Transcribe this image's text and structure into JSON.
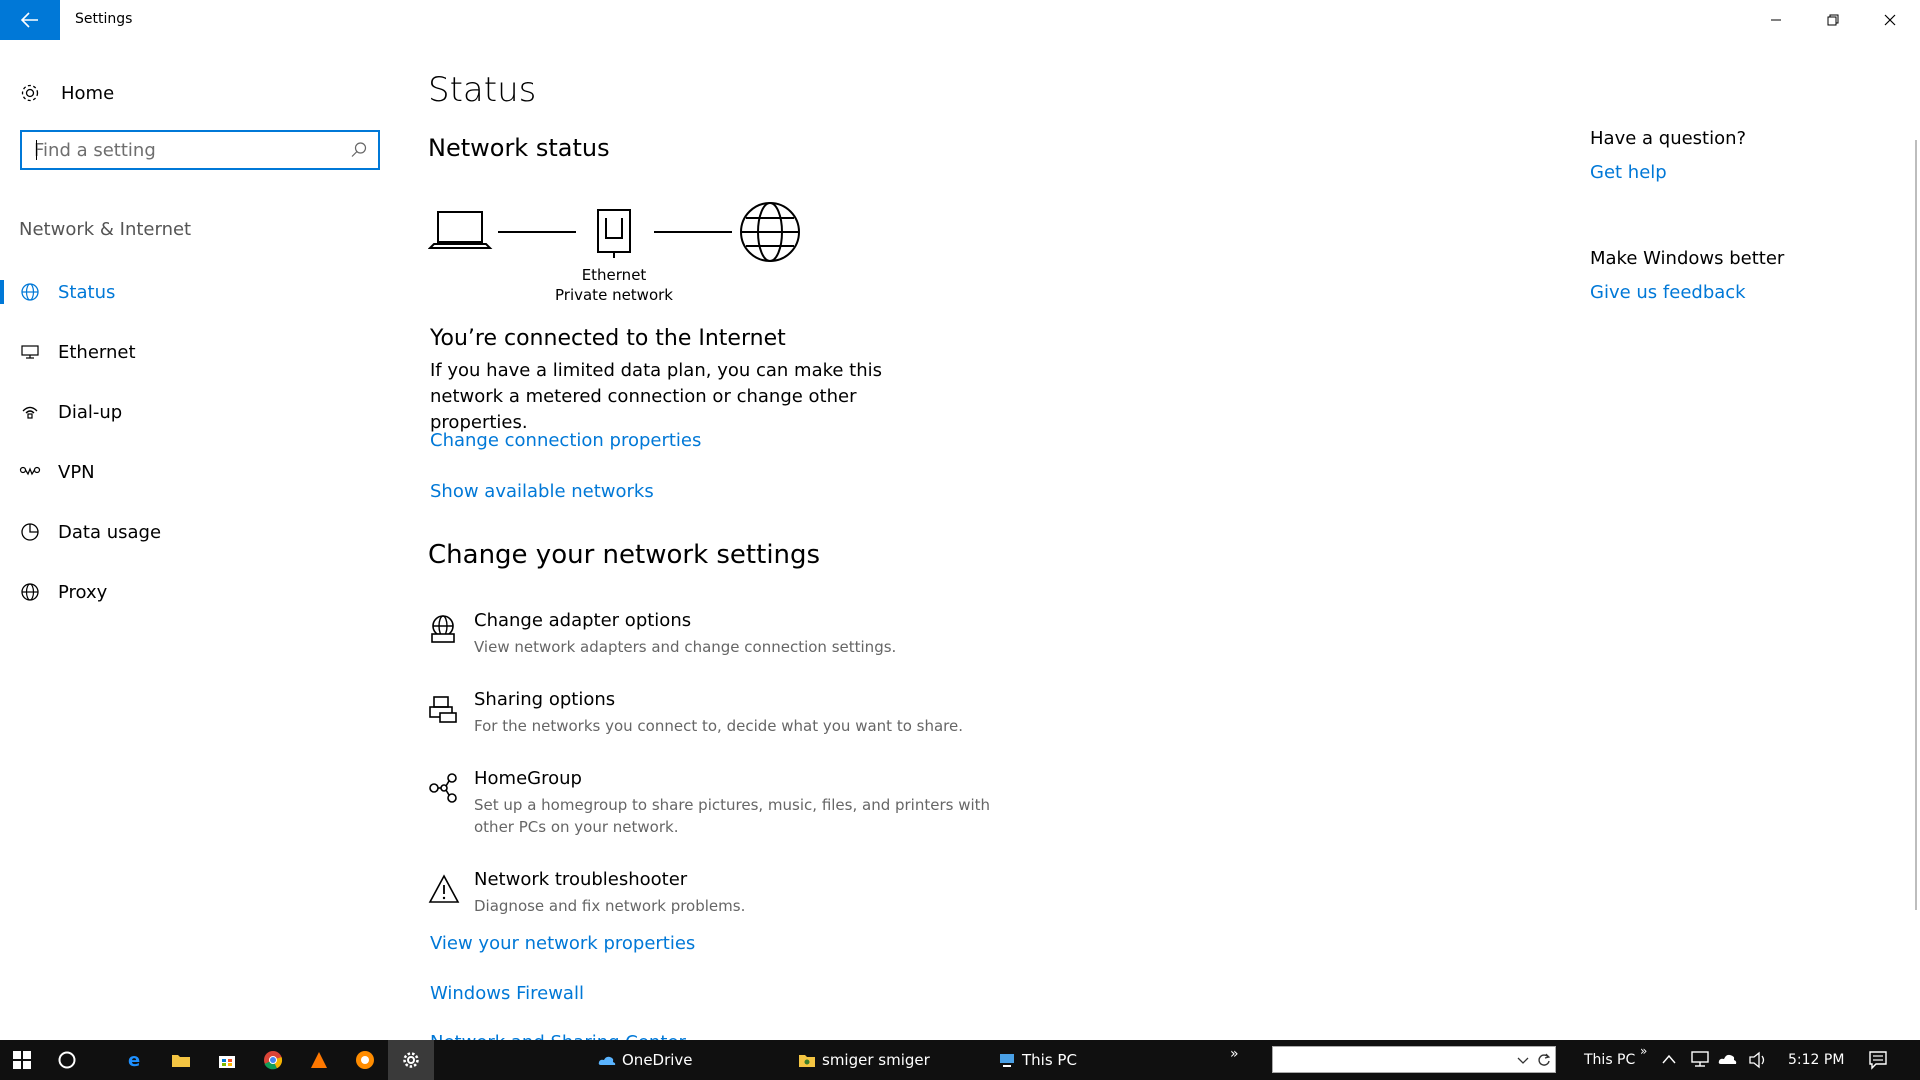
{
  "window": {
    "title": "Settings",
    "controls": [
      "minimize-icon",
      "restore-icon",
      "close-icon"
    ]
  },
  "sidebar": {
    "home_label": "Home",
    "search_placeholder": "Find a setting",
    "section_label": "Network & Internet",
    "items": [
      {
        "label": "Status",
        "icon": "globe-icon",
        "active": true
      },
      {
        "label": "Ethernet",
        "icon": "ethernet-icon",
        "active": false
      },
      {
        "label": "Dial-up",
        "icon": "dialup-icon",
        "active": false
      },
      {
        "label": "VPN",
        "icon": "vpn-icon",
        "active": false
      },
      {
        "label": "Data usage",
        "icon": "data-usage-icon",
        "active": false
      },
      {
        "label": "Proxy",
        "icon": "proxy-icon",
        "active": false
      }
    ]
  },
  "main": {
    "page_title": "Status",
    "network_status_title": "Network status",
    "diagram": {
      "adapter_name": "Ethernet",
      "network_type": "Private network"
    },
    "connected_title": "You’re connected to the Internet",
    "connected_desc": "If you have a limited data plan, you can make this network a metered connection or change other properties.",
    "link_change_properties": "Change connection properties",
    "link_show_networks": "Show available networks",
    "change_settings_title": "Change your network settings",
    "options": [
      {
        "title": "Change adapter options",
        "desc": "View network adapters and change connection settings.",
        "icon": "adapter-icon"
      },
      {
        "title": "Sharing options",
        "desc": "For the networks you connect to, decide what you want to share.",
        "icon": "sharing-icon"
      },
      {
        "title": "HomeGroup",
        "desc": "Set up a homegroup to share pictures, music, files, and printers with other PCs on your network.",
        "icon": "homegroup-icon"
      },
      {
        "title": "Network troubleshooter",
        "desc": "Diagnose and fix network problems.",
        "icon": "warning-icon"
      }
    ],
    "link_view_properties": "View your network properties",
    "link_firewall": "Windows Firewall",
    "link_sharing_center": "Network and Sharing Center"
  },
  "right_panel": {
    "question_title": "Have a question?",
    "get_help": "Get help",
    "better_title": "Make Windows better",
    "feedback": "Give us feedback"
  },
  "taskbar": {
    "tasks": [
      {
        "label": "OneDrive",
        "icon": "onedrive-icon"
      },
      {
        "label": "smiger smiger",
        "icon": "user-folder-icon"
      },
      {
        "label": "This PC",
        "icon": "this-pc-icon"
      }
    ],
    "address_label": "This PC",
    "time": "5:12 PM"
  },
  "colors": {
    "accent": "#0078d7",
    "taskbar": "#101010"
  }
}
